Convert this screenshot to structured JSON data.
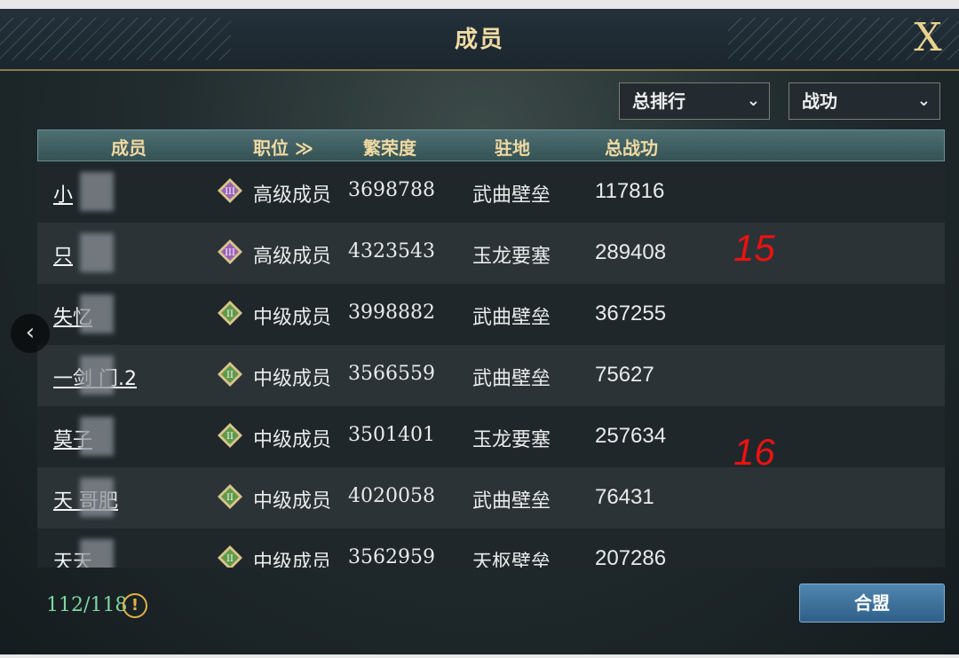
{
  "title": "成员",
  "close_label": "X",
  "filters": {
    "sort_value": "总排行",
    "metric_value": "战功"
  },
  "table": {
    "headers": {
      "member": "成员",
      "position": "职位 ≫",
      "prosperity": "繁荣度",
      "base": "驻地",
      "total_power": "总战功"
    },
    "rows": [
      {
        "name": "小",
        "rank_numeral": "III",
        "position": "高级成员",
        "prosperity": "3698788",
        "base": "武曲壁垒",
        "power": "117816"
      },
      {
        "name": "只",
        "rank_numeral": "III",
        "position": "高级成员",
        "prosperity": "4323543",
        "base": "玉龙要塞",
        "power": "289408"
      },
      {
        "name": "失忆",
        "rank_numeral": "II",
        "position": "中级成员",
        "prosperity": "3998882",
        "base": "武曲壁垒",
        "power": "367255"
      },
      {
        "name": "一剑 门.2",
        "rank_numeral": "II",
        "position": "中级成员",
        "prosperity": "3566559",
        "base": "武曲壁垒",
        "power": "75627"
      },
      {
        "name": "莫子",
        "rank_numeral": "II",
        "position": "中级成员",
        "prosperity": "3501401",
        "base": "玉龙要塞",
        "power": "257634"
      },
      {
        "name": "天 哥肥",
        "rank_numeral": "II",
        "position": "中级成员",
        "prosperity": "4020058",
        "base": "武曲壁垒",
        "power": "76431"
      },
      {
        "name": "天天",
        "rank_numeral": "II",
        "position": "中级成员",
        "prosperity": "3562959",
        "base": "天枢壁垒",
        "power": "207286"
      }
    ]
  },
  "member_count": "112/118",
  "info_icon_glyph": "!",
  "alliance_button": "合盟",
  "back_arrow": "‹",
  "annotations": [
    "15",
    "16"
  ],
  "colors": {
    "title_gold": "#f1dca4",
    "count_green": "#7fd6a1",
    "annotation_red": "#e11",
    "button_blue": "#2f5f88"
  }
}
